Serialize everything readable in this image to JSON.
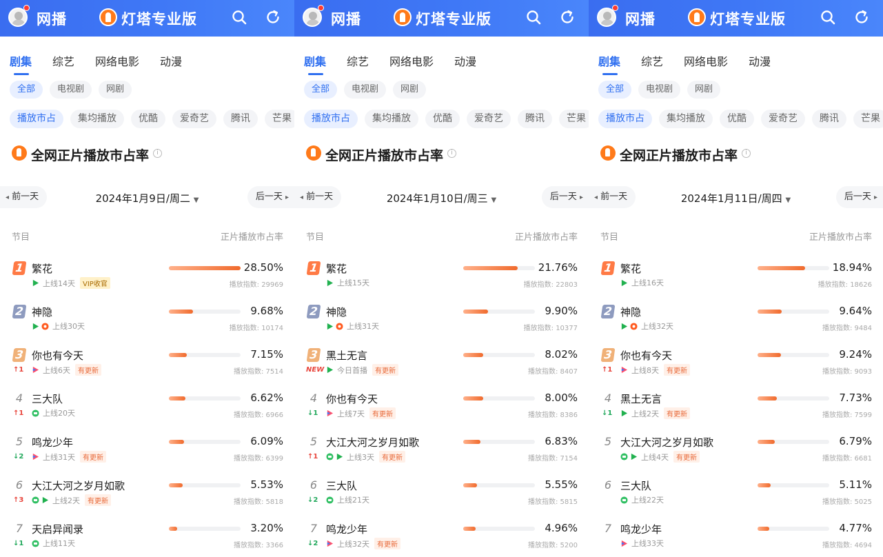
{
  "colors": {
    "accent": "#2f6ff0",
    "header": "#3f78f6",
    "bar": "#f06a2c",
    "up": "#e8453c",
    "down": "#21a85b"
  },
  "header": {
    "brand": "网播",
    "pro_name": "灯塔专业版"
  },
  "tabs": [
    "剧集",
    "综艺",
    "网络电影",
    "动漫"
  ],
  "chips": [
    "全部",
    "电视剧",
    "网剧"
  ],
  "platforms": [
    "播放市占",
    "集均播放",
    "优酷",
    "爱奇艺",
    "腾讯",
    "芒果"
  ],
  "section_title": "全网正片播放市占率",
  "info_glyph": "i",
  "prev_day": "前一天",
  "next_day": "后一天",
  "col_program": "节目",
  "col_share": "正片播放市占率",
  "index_label": "播放指数",
  "panels": [
    {
      "date": "2024年1月9日/周二",
      "rows": [
        {
          "rank": "1",
          "title": "繁花",
          "platforms": [
            "iqiyi"
          ],
          "days": "上线14天",
          "tag": "VIP收官",
          "tag_type": "vip",
          "change": "",
          "share": "28.50%",
          "share_value": 28.5,
          "index": "29969"
        },
        {
          "rank": "2",
          "title": "神隐",
          "platforms": [
            "iqiyi",
            "youku"
          ],
          "days": "上线30天",
          "tag": "",
          "tag_type": "",
          "change": "",
          "share": "9.68%",
          "share_value": 9.68,
          "index": "10174"
        },
        {
          "rank": "3",
          "title": "你也有今天",
          "platforms": [
            "tencent"
          ],
          "days": "上线6天",
          "tag": "有更新",
          "tag_type": "upd",
          "change": "↑1",
          "change_type": "up",
          "share": "7.15%",
          "share_value": 7.15,
          "index": "7514"
        },
        {
          "rank": "4",
          "title": "三大队",
          "platforms": [
            "cctv"
          ],
          "days": "上线20天",
          "tag": "",
          "tag_type": "",
          "change": "↑1",
          "change_type": "up",
          "share": "6.62%",
          "share_value": 6.62,
          "index": "6966"
        },
        {
          "rank": "5",
          "title": "鸣龙少年",
          "platforms": [
            "tencent"
          ],
          "days": "上线31天",
          "tag": "有更新",
          "tag_type": "upd",
          "change": "↓2",
          "change_type": "down",
          "share": "6.09%",
          "share_value": 6.09,
          "index": "6399"
        },
        {
          "rank": "6",
          "title": "大江大河之岁月如歌",
          "platforms": [
            "cctv",
            "iqiyi"
          ],
          "days": "上线2天",
          "tag": "有更新",
          "tag_type": "upd",
          "change": "↑3",
          "change_type": "up",
          "share": "5.53%",
          "share_value": 5.53,
          "index": "5818"
        },
        {
          "rank": "7",
          "title": "天启异闻录",
          "platforms": [
            "cctv"
          ],
          "days": "上线11天",
          "tag": "",
          "tag_type": "",
          "change": "↓1",
          "change_type": "down",
          "share": "3.20%",
          "share_value": 3.2,
          "index": "3366"
        }
      ]
    },
    {
      "date": "2024年1月10日/周三",
      "rows": [
        {
          "rank": "1",
          "title": "繁花",
          "platforms": [
            "iqiyi"
          ],
          "days": "上线15天",
          "tag": "",
          "tag_type": "",
          "change": "",
          "share": "21.76%",
          "share_value": 21.76,
          "index": "22803"
        },
        {
          "rank": "2",
          "title": "神隐",
          "platforms": [
            "iqiyi",
            "youku"
          ],
          "days": "上线31天",
          "tag": "",
          "tag_type": "",
          "change": "",
          "share": "9.90%",
          "share_value": 9.9,
          "index": "10377"
        },
        {
          "rank": "3",
          "title": "黑土无言",
          "platforms": [
            "iqiyi"
          ],
          "days": "今日首播",
          "tag": "有更新",
          "tag_type": "upd",
          "change": "NEW",
          "change_type": "new",
          "share": "8.02%",
          "share_value": 8.02,
          "index": "8407"
        },
        {
          "rank": "4",
          "title": "你也有今天",
          "platforms": [
            "tencent"
          ],
          "days": "上线7天",
          "tag": "有更新",
          "tag_type": "upd",
          "change": "↓1",
          "change_type": "down",
          "share": "8.00%",
          "share_value": 8.0,
          "index": "8386"
        },
        {
          "rank": "5",
          "title": "大江大河之岁月如歌",
          "platforms": [
            "cctv",
            "iqiyi"
          ],
          "days": "上线3天",
          "tag": "有更新",
          "tag_type": "upd",
          "change": "↑1",
          "change_type": "up",
          "share": "6.83%",
          "share_value": 6.83,
          "index": "7154"
        },
        {
          "rank": "6",
          "title": "三大队",
          "platforms": [
            "cctv"
          ],
          "days": "上线21天",
          "tag": "",
          "tag_type": "",
          "change": "↓2",
          "change_type": "down",
          "share": "5.55%",
          "share_value": 5.55,
          "index": "5815"
        },
        {
          "rank": "7",
          "title": "鸣龙少年",
          "platforms": [
            "tencent"
          ],
          "days": "上线32天",
          "tag": "有更新",
          "tag_type": "upd",
          "change": "↓2",
          "change_type": "down",
          "share": "4.96%",
          "share_value": 4.96,
          "index": "5200"
        }
      ]
    },
    {
      "date": "2024年1月11日/周四",
      "rows": [
        {
          "rank": "1",
          "title": "繁花",
          "platforms": [
            "iqiyi"
          ],
          "days": "上线16天",
          "tag": "",
          "tag_type": "",
          "change": "",
          "share": "18.94%",
          "share_value": 18.94,
          "index": "18626"
        },
        {
          "rank": "2",
          "title": "神隐",
          "platforms": [
            "iqiyi",
            "youku"
          ],
          "days": "上线32天",
          "tag": "",
          "tag_type": "",
          "change": "",
          "share": "9.64%",
          "share_value": 9.64,
          "index": "9484"
        },
        {
          "rank": "3",
          "title": "你也有今天",
          "platforms": [
            "tencent"
          ],
          "days": "上线8天",
          "tag": "有更新",
          "tag_type": "upd",
          "change": "↑1",
          "change_type": "up",
          "share": "9.24%",
          "share_value": 9.24,
          "index": "9093"
        },
        {
          "rank": "4",
          "title": "黑土无言",
          "platforms": [
            "iqiyi"
          ],
          "days": "上线2天",
          "tag": "有更新",
          "tag_type": "upd",
          "change": "↓1",
          "change_type": "down",
          "share": "7.73%",
          "share_value": 7.73,
          "index": "7599"
        },
        {
          "rank": "5",
          "title": "大江大河之岁月如歌",
          "platforms": [
            "cctv",
            "iqiyi"
          ],
          "days": "上线4天",
          "tag": "有更新",
          "tag_type": "upd",
          "change": "",
          "share": "6.79%",
          "share_value": 6.79,
          "index": "6681"
        },
        {
          "rank": "6",
          "title": "三大队",
          "platforms": [
            "cctv"
          ],
          "days": "上线22天",
          "tag": "",
          "tag_type": "",
          "change": "",
          "share": "5.11%",
          "share_value": 5.11,
          "index": "5025"
        },
        {
          "rank": "7",
          "title": "鸣龙少年",
          "platforms": [
            "tencent"
          ],
          "days": "上线33天",
          "tag": "",
          "tag_type": "",
          "change": "",
          "share": "4.77%",
          "share_value": 4.77,
          "index": "4694"
        }
      ]
    }
  ]
}
